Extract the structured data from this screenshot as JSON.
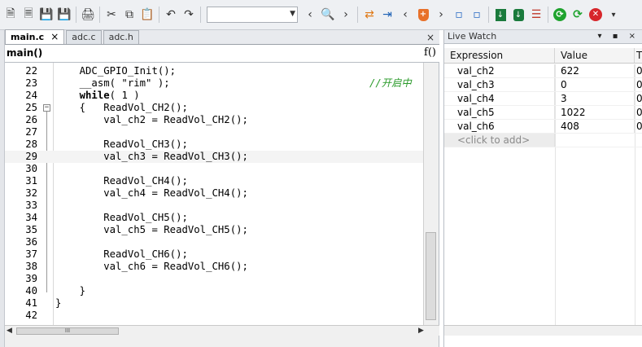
{
  "toolbar": {
    "icons": [
      "new-file-icon",
      "open-folder-icon",
      "save-icon",
      "save-all-icon",
      "print-icon",
      "cut-icon",
      "copy-icon",
      "paste-icon",
      "undo-icon",
      "redo-icon",
      "find-icon",
      "nav-back-icon",
      "nav-forward-icon",
      "bookmark-icon",
      "prev-bookmark-icon",
      "next-bookmark-icon",
      "shield-icon",
      "indent-icon",
      "unindent-icon",
      "download-icon",
      "download-alt-icon",
      "config-icon",
      "run-icon",
      "reset-icon",
      "stop-icon"
    ],
    "combo_value": ""
  },
  "editor": {
    "tabs": [
      {
        "label": "main.c",
        "active": true
      },
      {
        "label": "adc.c",
        "active": false
      },
      {
        "label": "adc.h",
        "active": false
      }
    ],
    "tab_close": "×",
    "close_all": "×",
    "function_label": "main()",
    "function_icon": "f()",
    "lines": [
      {
        "num": "22",
        "code": "    ADC_GPIO_Init();"
      },
      {
        "num": "23",
        "code": "    __asm( \"rim\" );",
        "comment": "//开启中"
      },
      {
        "num": "24",
        "kw": "while",
        "code": "( 1 )",
        "indent": "    "
      },
      {
        "num": "25",
        "code": "    {   ReadVol_CH2();",
        "fold": "−"
      },
      {
        "num": "26",
        "code": "        val_ch2 = ReadVol_CH2();"
      },
      {
        "num": "27",
        "code": ""
      },
      {
        "num": "28",
        "code": "        ReadVol_CH3();"
      },
      {
        "num": "29",
        "code": "        val_ch3 = ReadVol_CH3();",
        "current": true
      },
      {
        "num": "30",
        "code": ""
      },
      {
        "num": "31",
        "code": "        ReadVol_CH4();"
      },
      {
        "num": "32",
        "code": "        val_ch4 = ReadVol_CH4();"
      },
      {
        "num": "33",
        "code": ""
      },
      {
        "num": "34",
        "code": "        ReadVol_CH5();"
      },
      {
        "num": "35",
        "code": "        val_ch5 = ReadVol_CH5();"
      },
      {
        "num": "36",
        "code": ""
      },
      {
        "num": "37",
        "code": "        ReadVol_CH6();"
      },
      {
        "num": "38",
        "code": "        val_ch6 = ReadVol_CH6();"
      },
      {
        "num": "39",
        "code": ""
      },
      {
        "num": "40",
        "code": "    }"
      },
      {
        "num": "41",
        "code": "}"
      },
      {
        "num": "42",
        "code": ""
      }
    ],
    "hscroll_thumb": "III"
  },
  "watch": {
    "title": "Live Watch",
    "title_controls": "▾ ▪ ×",
    "headers": {
      "expression": "Expression",
      "value": "Value",
      "type": "T"
    },
    "rows": [
      {
        "expr": "val_ch2",
        "value": "622",
        "type": "0"
      },
      {
        "expr": "val_ch3",
        "value": "0",
        "type": "0"
      },
      {
        "expr": "val_ch4",
        "value": "3",
        "type": "0"
      },
      {
        "expr": "val_ch5",
        "value": "1022",
        "type": "0"
      },
      {
        "expr": "val_ch6",
        "value": "408",
        "type": "0"
      }
    ],
    "add_placeholder": "<click to add>"
  }
}
